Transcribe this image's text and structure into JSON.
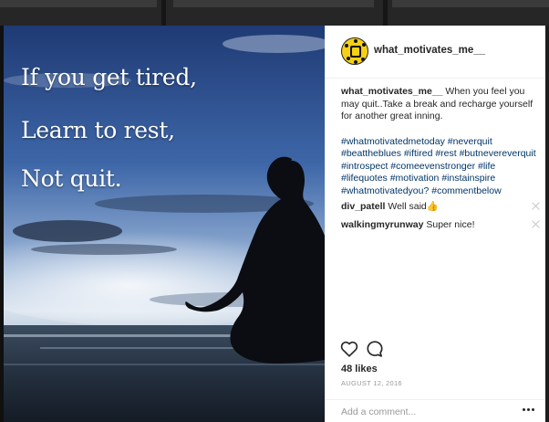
{
  "post": {
    "image_text": [
      "If you get tired,",
      "Learn to rest,",
      "Not quit."
    ],
    "username": "what_motivates_me__",
    "caption": {
      "username": "what_motivates_me__",
      "text": "When you feel you may quit..Take a break and recharge yourself for another great inning.",
      "hashtags": "#whatmotivatedmetoday #neverquit #beattheblues #iftired #rest #butnevereverquit #introspect #comeevenstronger #life #lifequotes #motivation #instainspire #whatmotivatedyou? #commentbelow"
    },
    "comments": [
      {
        "username": "div_patell",
        "text": "Well said👍"
      },
      {
        "username": "walkingmyrunway",
        "text": "Super nice!"
      }
    ],
    "likes": "48 likes",
    "date": "AUGUST 12, 2016",
    "comment_placeholder": "Add a comment...",
    "icons": {
      "like": "heart-icon",
      "comment": "comment-bubble-icon",
      "more": "more-options-icon"
    }
  }
}
